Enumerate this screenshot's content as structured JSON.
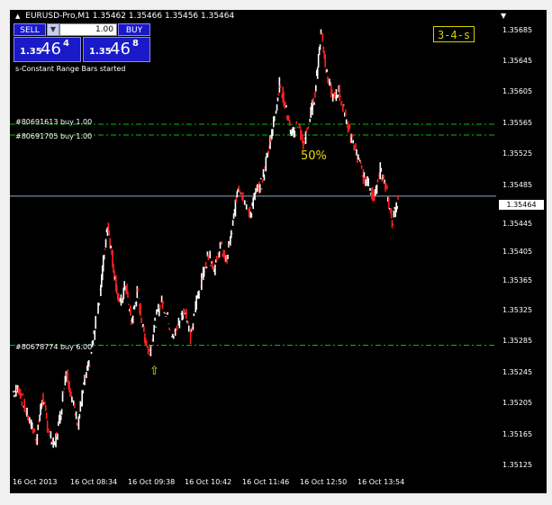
{
  "chart": {
    "title_symbol": "EURUSD-Pro,M1",
    "title_prices": "1.35462 1.35466 1.35456 1.35464",
    "status": "s-Constant Range Bars started",
    "indicator_label": "3-4-s",
    "fib_label": "50%",
    "up_arrow": "⇧"
  },
  "trade_panel": {
    "sell_label": "SELL",
    "buy_label": "BUY",
    "lot_value": "1.00",
    "lot_arrow": "▼",
    "sell_small": "1.35",
    "sell_big": "46",
    "sell_sup": "4",
    "buy_small": "1.35",
    "buy_big": "46",
    "buy_sup": "8"
  },
  "orders": [
    {
      "label": "#80691613 buy 1.00",
      "price": 1.35557
    },
    {
      "label": "#80691705 buy 1.00",
      "price": 1.35543
    },
    {
      "label": "#80678774 buy 6.00",
      "price": 1.35271
    }
  ],
  "current_price": "1.35464",
  "price_axis": [
    "1.35685",
    "1.35645",
    "1.35605",
    "1.35565",
    "1.35525",
    "1.35485",
    "1.35445",
    "1.35405",
    "1.35365",
    "1.35325",
    "1.35285",
    "1.35245",
    "1.35205",
    "1.35165",
    "1.35125"
  ],
  "time_axis": [
    "16 Oct 2013",
    "16 Oct 08:34",
    "16 Oct 09:38",
    "16 Oct 10:42",
    "16 Oct 11:46",
    "16 Oct 12:50",
    "16 Oct 13:54"
  ],
  "colors": {
    "background": "#000000",
    "bull": "#ffffff",
    "bear": "#ff2020",
    "order_line": "#00c000",
    "current_price_line": "#8fa8c8",
    "panel_blue": "#1a1ac8",
    "yellow": "#e8e000"
  },
  "chart_data": {
    "type": "line",
    "title": "EURUSD-Pro,M1",
    "xlabel": "",
    "ylabel": "",
    "ylim": [
      1.35105,
      1.35705
    ],
    "x": [
      "16 Oct 2013",
      "16 Oct 08:34",
      "16 Oct 09:38",
      "16 Oct 10:42",
      "16 Oct 11:46",
      "16 Oct 12:50",
      "16 Oct 13:54"
    ],
    "series": [
      {
        "values": [
          1.3521,
          1.35215,
          1.3519,
          1.3517,
          1.3515,
          1.35205,
          1.3516,
          1.3514,
          1.3518,
          1.3524,
          1.352,
          1.3517,
          1.3522,
          1.3525,
          1.353,
          1.3536,
          1.3543,
          1.3537,
          1.3532,
          1.3535,
          1.353,
          1.3534,
          1.3529,
          1.3526,
          1.353,
          1.3533,
          1.3531,
          1.3528,
          1.353,
          1.3532,
          1.3528,
          1.3533,
          1.3536,
          1.3539,
          1.3537,
          1.354,
          1.3538,
          1.3542,
          1.3548,
          1.3546,
          1.3544,
          1.3547,
          1.3548,
          1.3552,
          1.3556,
          1.3561,
          1.3558,
          1.3554,
          1.3556,
          1.3553,
          1.3556,
          1.356,
          1.3568,
          1.3562,
          1.3559,
          1.356,
          1.3557,
          1.3554,
          1.3552,
          1.3549,
          1.3548,
          1.3546,
          1.355,
          1.3547,
          1.3543,
          1.35464
        ]
      }
    ]
  }
}
